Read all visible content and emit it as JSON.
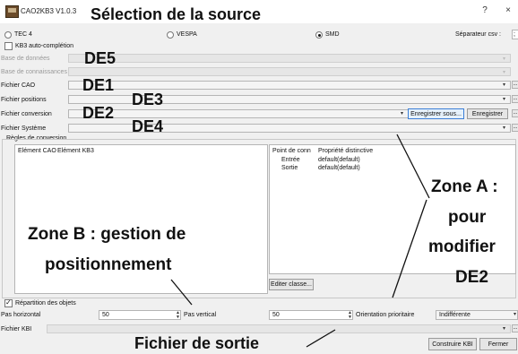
{
  "window": {
    "title": "CAO2KB3 V1.0.3",
    "help_label": "?",
    "close_label": "×"
  },
  "source": {
    "options": [
      {
        "label": "TEC 4",
        "selected": false
      },
      {
        "label": "VESPA",
        "selected": false
      },
      {
        "label": "SMD",
        "selected": true
      }
    ],
    "separator_label": "Séparateur csv :",
    "separator_value": ";"
  },
  "kb3": {
    "autocomplete_label": "KB3 auto-complétion",
    "autocomplete_checked": false,
    "database_label": "Base de données",
    "knowledge_label": "Base de connaissances"
  },
  "files": {
    "cao_label": "Fichier CAO",
    "positions_label": "Fichier positions",
    "conversion_label": "Fichier conversion",
    "system_label": "Fichier Système",
    "save_as_label": "Enregistrer sous...",
    "save_label": "Enregistrer",
    "dots_label": "..."
  },
  "rules": {
    "group_label": "Règles de conversion",
    "left_headers": [
      "Elément CAO",
      "Elément KB3"
    ],
    "right_headers": [
      "Point de conn",
      "Propriété distinctive"
    ],
    "right_rows": [
      {
        "point": "Entrée",
        "property": "default(default)"
      },
      {
        "point": "Sortie",
        "property": "default(default)"
      }
    ],
    "edit_class_label": "Editer classe..."
  },
  "distribution": {
    "checkbox_label": "Répartition des objets",
    "checkbox_checked": true,
    "h_step_label": "Pas horizontal",
    "h_step_value": "50",
    "v_step_label": "Pas vertical",
    "v_step_value": "50",
    "orientation_label": "Orientation prioritaire",
    "orientation_value": "Indifférente"
  },
  "output": {
    "kbi_label": "Fichier KBI",
    "build_label": "Construire KBI",
    "close_label": "Fermer"
  },
  "annotations": {
    "source_title": "Sélection de la source",
    "de5": "DE5",
    "de1": "DE1",
    "de3": "DE3",
    "de2": "DE2",
    "de4": "DE4",
    "zone_a_line1": "Zone A :",
    "zone_a_line2": "pour",
    "zone_a_line3": "modifier",
    "zone_a_line4": "DE2",
    "zone_b_line1": "Zone B : gestion de",
    "zone_b_line2": "positionnement",
    "output_file": "Fichier de sortie"
  }
}
